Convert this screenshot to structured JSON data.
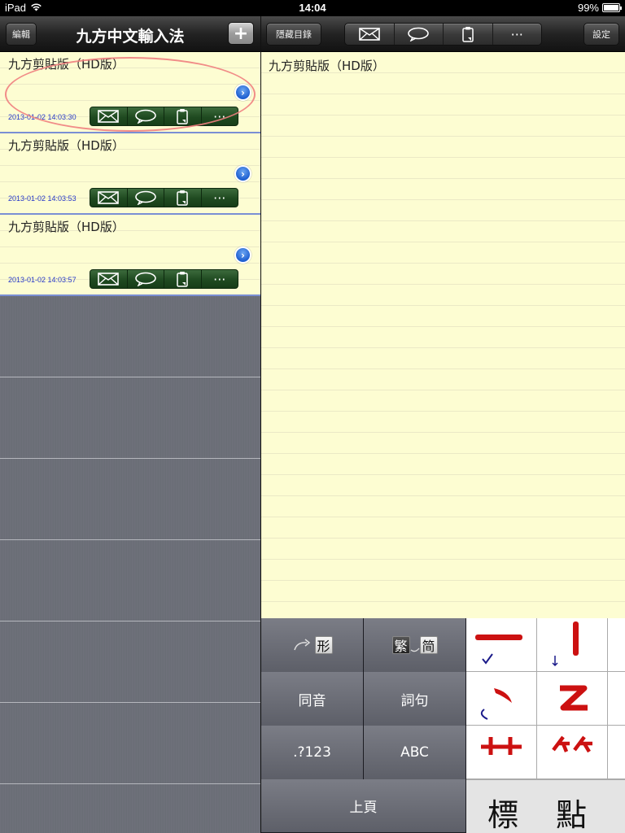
{
  "status_bar": {
    "device": "iPad",
    "time": "14:04",
    "battery": "99%",
    "battery_level": 0.99
  },
  "left_nav": {
    "edit_label": "編輯",
    "title": "九方中文輸入法",
    "add_label": "+"
  },
  "notes": [
    {
      "title": "九方剪貼版（HD版）",
      "date": "2013-01-02 14:03:30"
    },
    {
      "title": "九方剪貼版（HD版）",
      "date": "2013-01-02 14:03:53"
    },
    {
      "title": "九方剪貼版（HD版）",
      "date": "2013-01-02 14:03:57"
    }
  ],
  "cell_actions": {
    "more_label": "···"
  },
  "right_toolbar": {
    "hide_list_label": "隱藏目錄",
    "settings_label": "設定",
    "more_label": "···"
  },
  "editor": {
    "text": "九方剪貼版（HD版）"
  },
  "keyboard": {
    "shape_key": "形",
    "trad_key": "繁",
    "simp_key": "简",
    "homophone_key": "同音",
    "phrase_key": "詞句",
    "symbols_key": ".?123",
    "abc_key": "ABC",
    "prev_page_key": "上頁",
    "candidates": [
      "標",
      "點"
    ]
  },
  "icons": {
    "wifi": "wifi-icon",
    "mail": "mail-icon",
    "chat": "speech-bubble-icon",
    "copy": "clipboard-icon",
    "more": "ellipsis-icon",
    "disclosure": "disclosure-arrow-icon"
  },
  "colors": {
    "paper": "#fdfdd2",
    "date_text": "#2536c8",
    "stroke_red": "#cc1111",
    "action_green": "#1f4a20",
    "disclosure_blue": "#1e5fd0"
  }
}
